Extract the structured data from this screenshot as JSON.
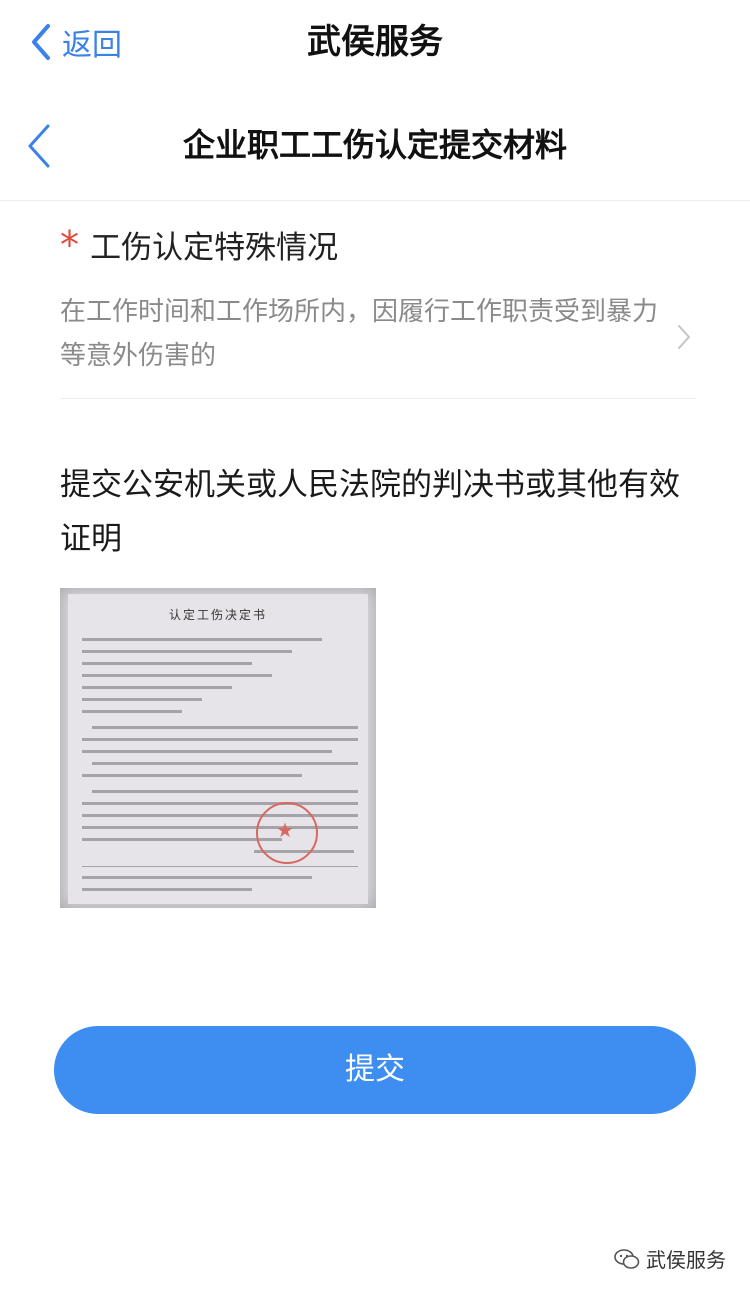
{
  "topbar": {
    "back_label": "返回",
    "app_title": "武侯服务"
  },
  "page": {
    "title": "企业职工工伤认定提交材料"
  },
  "field": {
    "required_mark": "*",
    "label": "工伤认定特殊情况",
    "value": "在工作时间和工作场所内，因履行工作职责受到暴力等意外伤害的"
  },
  "instruction": "提交公安机关或人民法院的判决书或其他有效证明",
  "document": {
    "title": "认定工伤决定书"
  },
  "submit": {
    "label": "提交"
  },
  "watermark": {
    "text": "武侯服务"
  },
  "colors": {
    "accent": "#3b82e6",
    "button": "#3d8ef0",
    "required": "#e0483a"
  }
}
